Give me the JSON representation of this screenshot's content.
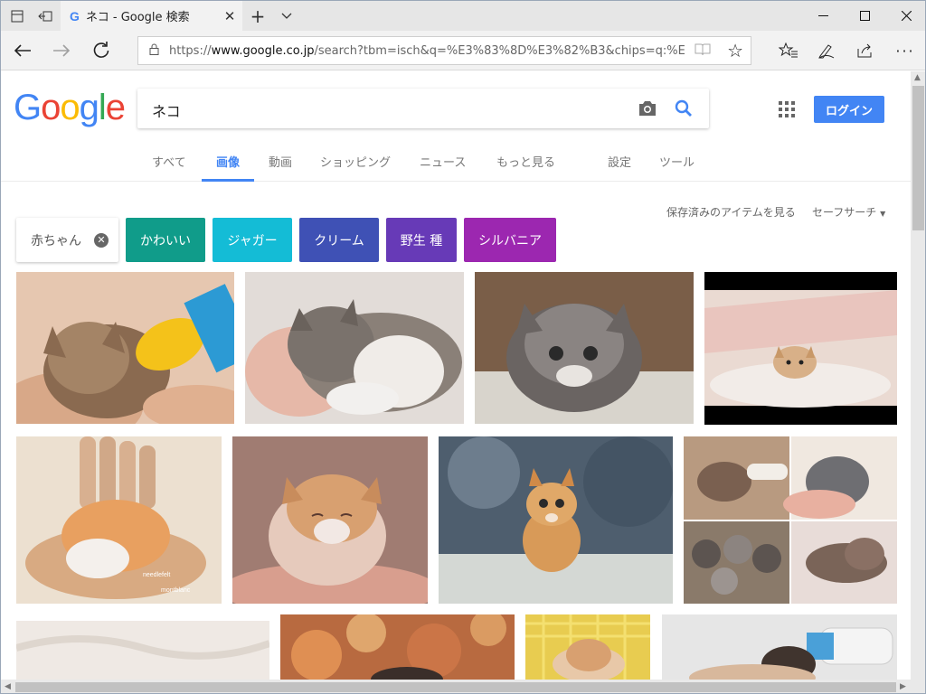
{
  "browser": {
    "tab_title": "ネコ - Google 検索",
    "tab_favicon": "G",
    "url_prefix": "https://",
    "url_domain": "www.google.co.jp",
    "url_path": "/search?tbm=isch&q=%E3%83%8D%E3%82%B3&chips=q:%E3%83%8D%",
    "icons": {
      "tab_list": "tab-list-icon",
      "tab_aside": "set-tabs-aside-icon",
      "close_tab": "close-icon",
      "new_tab": "plus-icon",
      "tab_menu": "chevron-down-icon",
      "minimize": "minimize-icon",
      "maximize": "maximize-icon",
      "close_window": "close-icon",
      "back": "arrow-left-icon",
      "forward": "arrow-right-icon",
      "refresh": "refresh-icon",
      "lock": "lock-icon",
      "reading_view": "reading-view-icon",
      "favorite": "star-icon",
      "favorites_hub": "favorites-list-icon",
      "ink": "pen-icon",
      "share": "share-icon",
      "more": "more-icon"
    }
  },
  "google": {
    "logo_letters": [
      {
        "ch": "G",
        "color": "#4285f4"
      },
      {
        "ch": "o",
        "color": "#ea4335"
      },
      {
        "ch": "o",
        "color": "#fbbc05"
      },
      {
        "ch": "g",
        "color": "#4285f4"
      },
      {
        "ch": "l",
        "color": "#34a853"
      },
      {
        "ch": "e",
        "color": "#ea4335"
      }
    ],
    "query": "ネコ",
    "login_label": "ログイン",
    "tabs": [
      {
        "label": "すべて",
        "active": false
      },
      {
        "label": "画像",
        "active": true
      },
      {
        "label": "動画",
        "active": false
      },
      {
        "label": "ショッピング",
        "active": false
      },
      {
        "label": "ニュース",
        "active": false
      },
      {
        "label": "もっと見る",
        "active": false
      },
      {
        "label": "設定",
        "active": false
      },
      {
        "label": "ツール",
        "active": false
      }
    ],
    "saved_items_link": "保存済みのアイテムを見る",
    "safesearch_label": "セーフサーチ",
    "chips": [
      {
        "label": "赤ちゃん",
        "color": "#ffffff",
        "removable": true
      },
      {
        "label": "かわいい",
        "color": "#109c8a",
        "removable": false
      },
      {
        "label": "ジャガー",
        "color": "#14bcd6",
        "removable": false
      },
      {
        "label": "クリーム",
        "color": "#3f51b5",
        "removable": false
      },
      {
        "label": "野生 種",
        "color": "#673ab7",
        "removable": false
      },
      {
        "label": "シルバニア",
        "color": "#9c27b0",
        "removable": false
      }
    ],
    "accent_color": "#4285f4"
  },
  "images": [
    {
      "desc": "kitten drinking from bottle",
      "bg": "#e8c8a8",
      "fg": "#7a5a40"
    },
    {
      "desc": "sleeping kitten in hand",
      "bg": "#e4dcd6",
      "fg": "#6e6660"
    },
    {
      "desc": "fluffy grey kitten on blanket",
      "bg": "#8c7866",
      "fg": "#5c5c60"
    },
    {
      "desc": "tiny kitten in bed sheets",
      "bg": "#ead8d0",
      "fg": "#c8a080"
    },
    {
      "desc": "orange kitten on wooden hand",
      "bg": "#e8d8c0",
      "fg": "#d89a5a",
      "caption": "needlefelt",
      "caption2": "montblanc"
    },
    {
      "desc": "newborn kitten crying",
      "bg": "#9c7c70",
      "fg": "#e0c8b8"
    },
    {
      "desc": "orange kitten walking",
      "bg": "#5a6a7a",
      "fg": "#d8a060"
    },
    {
      "desc": "collage of kittens",
      "bg": "#c8b8a8",
      "fg": "#6a6060"
    },
    {
      "desc": "white fabric",
      "bg": "#ece6e0",
      "fg": "#d8d0c8"
    },
    {
      "desc": "bokeh lights",
      "bg": "#c87848",
      "fg": "#f0b070"
    },
    {
      "desc": "kitten in basket",
      "bg": "#e8d060",
      "fg": "#d8a070"
    },
    {
      "desc": "kitten with bottle",
      "bg": "#e4e4e4",
      "fg": "#403838"
    }
  ]
}
